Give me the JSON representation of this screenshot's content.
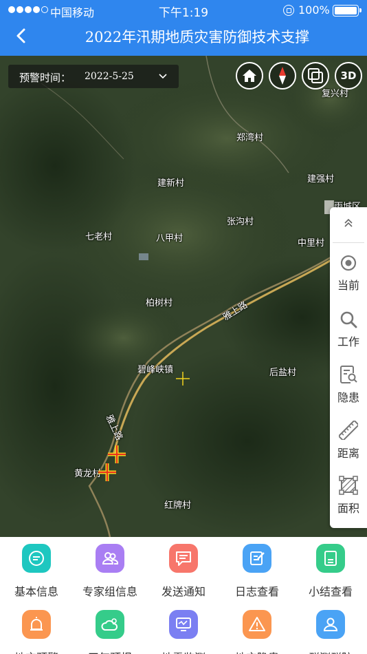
{
  "status_bar": {
    "carrier": "中国移动",
    "time": "下午1:19",
    "battery": "100%"
  },
  "nav": {
    "title": "2022年汛期地质灾害防御技术支撑"
  },
  "warning": {
    "label": "预警时间：",
    "date": "2022-5-25"
  },
  "map_controls": {
    "home": "home-icon",
    "compass": "compass-icon",
    "layers": "layers-icon",
    "view_3d": "3D"
  },
  "places": {
    "fuxing": "复兴村",
    "zhengwan": "郑湾村",
    "jianxin": "建新村",
    "jianqiang": "建强村",
    "yucheng": "雨城区",
    "zhanggou": "张沟村",
    "qilao": "七老村",
    "bajia": "八甲村",
    "zhongli": "中里村",
    "baishu": "柏树村",
    "yashang_road": "雅上路",
    "bifeng": "碧峰峡镇",
    "houyan": "后盐村",
    "yashang_road2": "雅上路",
    "huanglong": "黄龙村",
    "hongpai": "红牌村"
  },
  "tools": [
    {
      "label": "",
      "icon": "collapse-up-icon"
    },
    {
      "label": "当前",
      "icon": "locate-icon"
    },
    {
      "label": "工作",
      "icon": "search-icon"
    },
    {
      "label": "隐患",
      "icon": "doc-search-icon"
    },
    {
      "label": "距离",
      "icon": "ruler-icon"
    },
    {
      "label": "面积",
      "icon": "area-icon"
    }
  ],
  "grid": [
    {
      "label": "基本信息",
      "color": "#1ec7c0",
      "icon": "chat-icon"
    },
    {
      "label": "专家组信息",
      "color": "#a97ef3",
      "icon": "group-icon"
    },
    {
      "label": "发送通知",
      "color": "#f7766b",
      "icon": "message-icon"
    },
    {
      "label": "日志查看",
      "color": "#4aa3f5",
      "icon": "edit-icon"
    },
    {
      "label": "小结查看",
      "color": "#35cc8a",
      "icon": "summary-icon"
    },
    {
      "label": "地灾预警",
      "color": "#fb9650",
      "icon": "alarm-icon"
    },
    {
      "label": "天气预报",
      "color": "#35cc8a",
      "icon": "weather-icon"
    },
    {
      "label": "地震监测",
      "color": "#7b7ff2",
      "icon": "monitor-icon"
    },
    {
      "label": "地灾隐患",
      "color": "#fb9650",
      "icon": "warning-icon"
    },
    {
      "label": "群测群防",
      "color": "#4aa3f5",
      "icon": "people-icon"
    }
  ]
}
